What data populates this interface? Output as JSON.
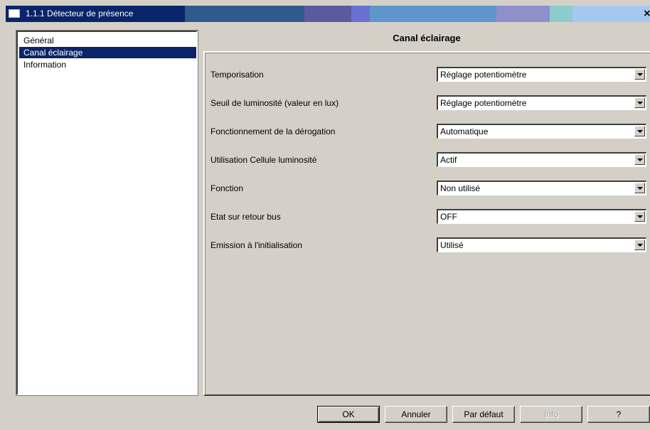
{
  "window": {
    "title": "1.1.1 Détecteur de présence",
    "close_glyph": "×"
  },
  "sidebar": {
    "items": [
      {
        "label": "Général",
        "selected": false
      },
      {
        "label": "Canal éclairage",
        "selected": true
      },
      {
        "label": "Information",
        "selected": false
      }
    ]
  },
  "panel": {
    "title": "Canal éclairage",
    "params": [
      {
        "label": "Temporisation",
        "value": "Réglage potentiomètre"
      },
      {
        "label": "Seuil de luminosité (valeur en lux)",
        "value": "Réglage potentiomètre"
      },
      {
        "label": "Fonctionnement de la dérogation",
        "value": "Automatique"
      },
      {
        "label": "Utilisation Cellule luminosité",
        "value": "Actif"
      },
      {
        "label": "Fonction",
        "value": "Non utilisé"
      },
      {
        "label": "Etat sur retour bus",
        "value": "OFF"
      },
      {
        "label": "Emission à l'initialisation",
        "value": "Utilisé"
      }
    ]
  },
  "buttons": {
    "ok": "OK",
    "cancel": "Annuler",
    "default": "Par défaut",
    "info": "Info",
    "help": "?"
  },
  "colors": {
    "selection": "#0a246a",
    "dialog_face": "#d4d0c8"
  }
}
